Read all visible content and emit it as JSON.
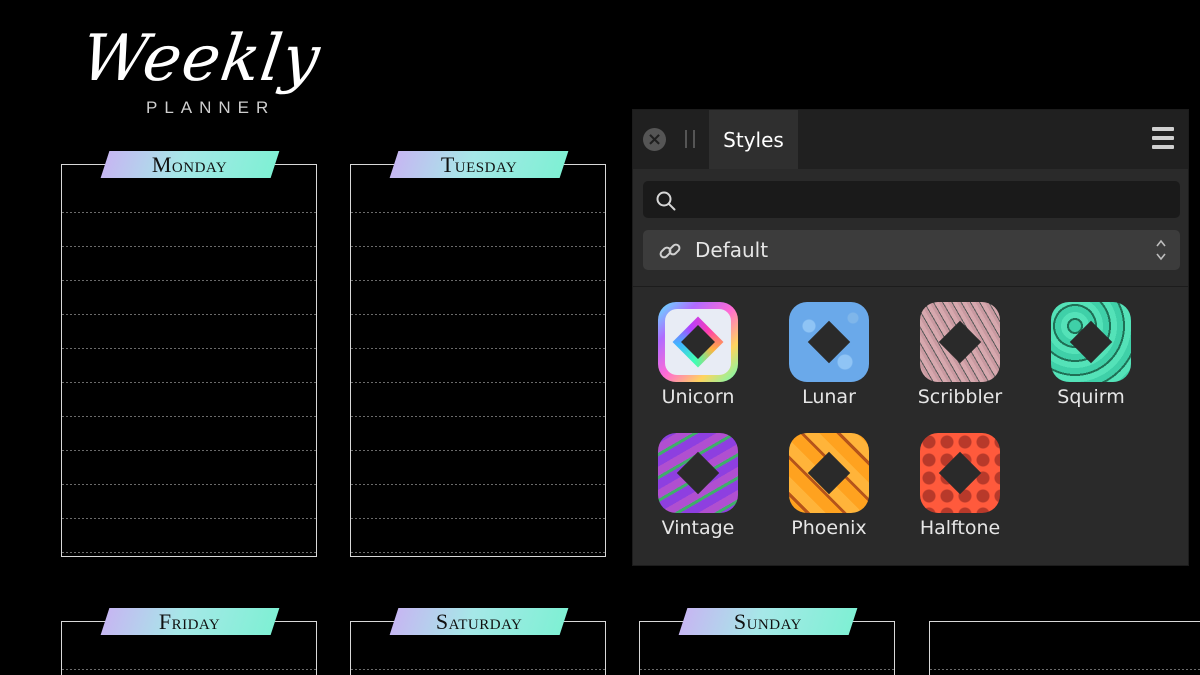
{
  "planner": {
    "title": "Weekly",
    "subtitle": "PLANNER",
    "days": {
      "monday": "Monday",
      "tuesday": "Tuesday",
      "friday": "Friday",
      "saturday": "Saturday",
      "sunday": "Sunday"
    }
  },
  "panel": {
    "tab_label": "Styles",
    "close_icon": "close-icon",
    "menu_icon": "hamburger-menu-icon",
    "search": {
      "value": "",
      "placeholder": ""
    },
    "category": {
      "icon": "link-icon",
      "label": "Default"
    },
    "styles": [
      {
        "label": "Unicorn",
        "icon": "unicorn-style-icon"
      },
      {
        "label": "Lunar",
        "icon": "lunar-style-icon"
      },
      {
        "label": "Scribbler",
        "icon": "scribbler-style-icon"
      },
      {
        "label": "Squirm",
        "icon": "squirm-style-icon"
      },
      {
        "label": "Vintage",
        "icon": "vintage-style-icon"
      },
      {
        "label": "Phoenix",
        "icon": "phoenix-style-icon"
      },
      {
        "label": "Halftone",
        "icon": "halftone-style-icon"
      }
    ]
  },
  "colors": {
    "background": "#000000",
    "panel": "#2a2a2a",
    "panel_header": "#202020",
    "tab_gradient_start": "#c6b7f2",
    "tab_gradient_end": "#7ff0d4"
  }
}
